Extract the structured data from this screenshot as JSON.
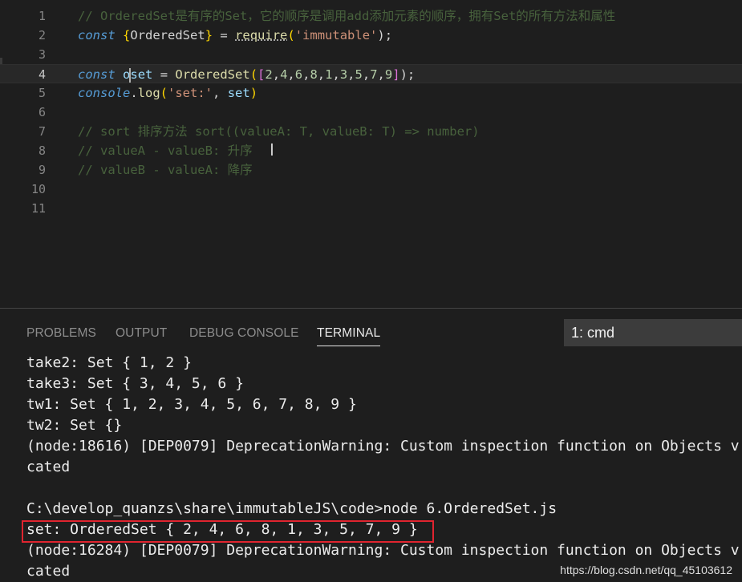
{
  "editor": {
    "line_numbers": [
      "1",
      "2",
      "3",
      "4",
      "5",
      "6",
      "7",
      "8",
      "9",
      "10",
      "11"
    ],
    "line1": "// OrderedSet是有序的Set，它的顺序是调用add添加元素的顺序，拥有Set的所有方法和属性",
    "line2": {
      "kw": "const",
      "open": "{",
      "name": "OrderedSet",
      "close": "}",
      "eq": " = ",
      "fn": "require",
      "p1": "(",
      "str": "'immutable'",
      "p2": ");"
    },
    "line4": {
      "kw": "const",
      "var_a": "o",
      "var_b": "set",
      "eq": " = ",
      "fn": "OrderedSet",
      "p1": "(",
      "b1": "[",
      "nums": [
        "2",
        "4",
        "6",
        "8",
        "1",
        "3",
        "5",
        "7",
        "9"
      ],
      "b2": "]",
      "p2": ");"
    },
    "line5": {
      "obj": "console",
      "dot": ".",
      "fn": "log",
      "p1": "(",
      "str": "'set:'",
      "comma": ", ",
      "arg": "set",
      "p2": ")"
    },
    "line7": "// sort 排序方法 sort((valueA: T, valueB: T) => number)",
    "line8": "// valueA - valueB: 升序",
    "line9": "// valueB - valueA: 降序"
  },
  "panel": {
    "tabs": [
      "PROBLEMS",
      "OUTPUT",
      "DEBUG CONSOLE",
      "TERMINAL"
    ],
    "active_tab": "TERMINAL",
    "terminal_select": "1: cmd",
    "lines": [
      "take2: Set { 1, 2 }",
      "take3: Set { 3, 4, 5, 6 }",
      "tw1: Set { 1, 2, 3, 4, 5, 6, 7, 8, 9 }",
      "tw2: Set {}",
      "(node:18616) [DEP0079] DeprecationWarning: Custom inspection function on Objects v",
      "cated",
      "",
      "C:\\develop_quanzs\\share\\immutableJS\\code>node 6.OrderedSet.js",
      "set: OrderedSet { 2, 4, 6, 8, 1, 3, 5, 7, 9 }",
      "(node:16284) [DEP0079] DeprecationWarning: Custom inspection function on Objects v",
      "cated"
    ]
  },
  "watermark": "https://blog.csdn.net/qq_45103612",
  "colors": {
    "highlight_box": "#e0242f",
    "keyword": "#569cd6",
    "string": "#ce9178",
    "function": "#dcdcaa"
  }
}
